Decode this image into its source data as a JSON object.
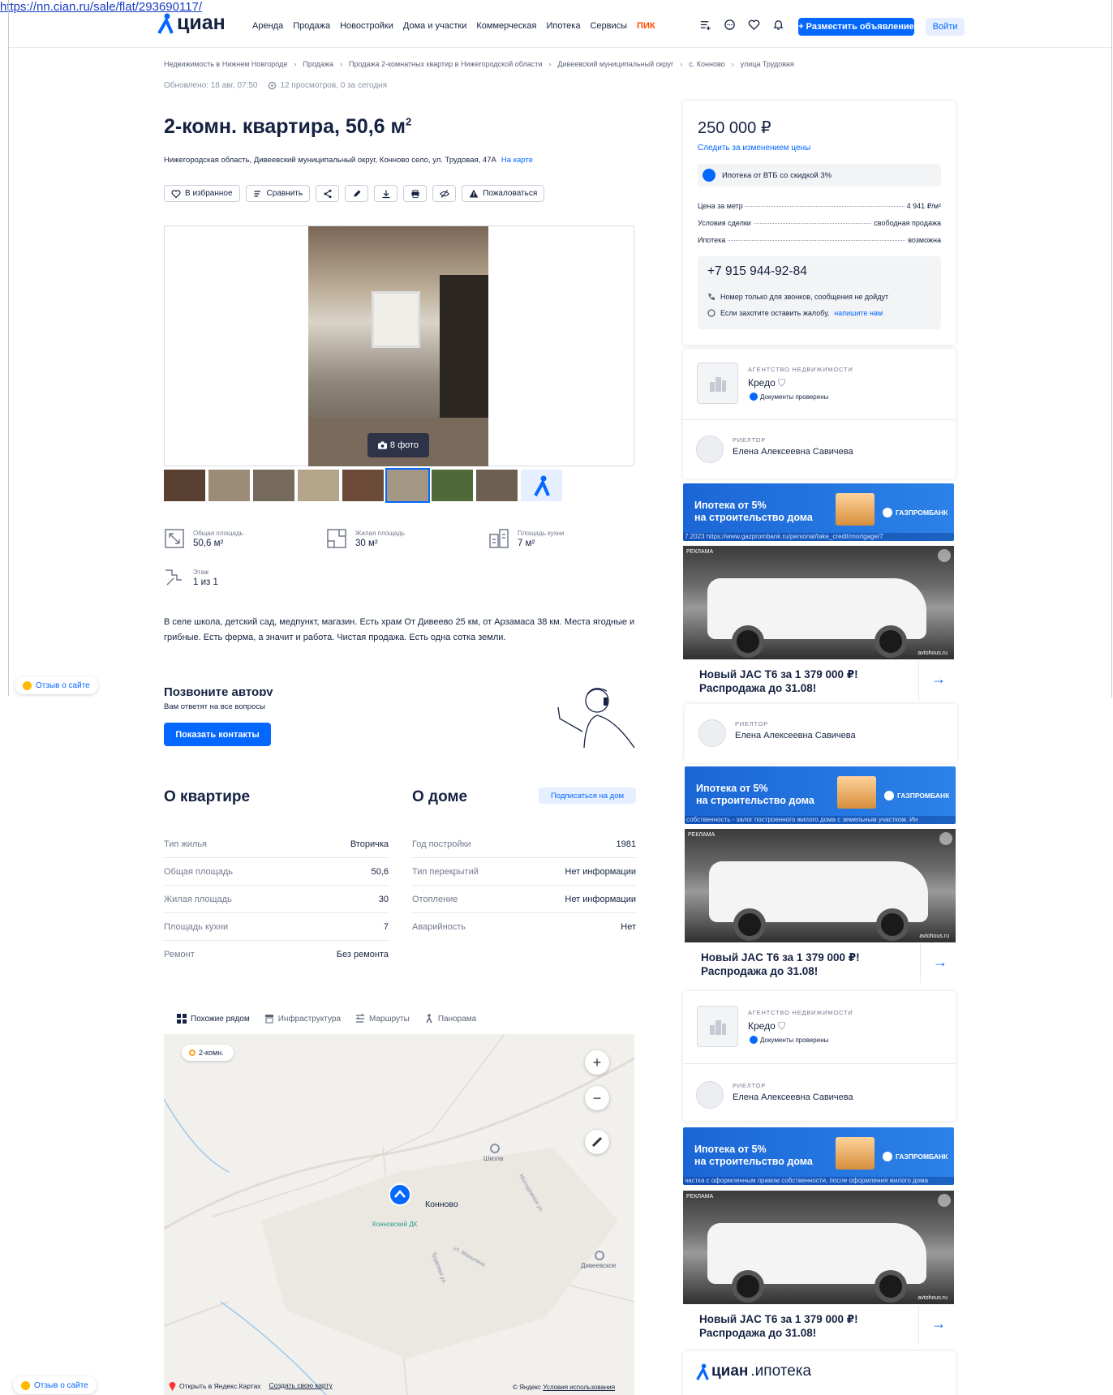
{
  "url": "https://nn.cian.ru/sale/flat/293690117/",
  "header": {
    "logo_text": "циан",
    "nav": [
      "Аренда",
      "Продажа",
      "Новостройки",
      "Дома и участки",
      "Коммерческая",
      "Ипотека",
      "Сервисы"
    ],
    "nav_pik": "ПИК",
    "post_button": "+ Разместить объявление",
    "login_button": "Войти"
  },
  "breadcrumbs": [
    "Недвижимость в Нижнем Новгороде",
    "Продажа",
    "Продажа 2-комнатных квартир в Нижегородской области",
    "Дивеевский муниципальный округ",
    "с. Конново",
    "улица Трудовая"
  ],
  "meta": {
    "updated": "Обновлено: 18 авг, 07:50",
    "views": "12 просмотров, 0 за сегодня"
  },
  "listing": {
    "title": "2-комн. квартира, 50,6 м",
    "title_sup": "2",
    "address": "Нижегородская область, Дивеевский муниципальный округ, Конново село, ул. Трудовая, 47А",
    "map_link": "На карте",
    "photo_count": "8 фото",
    "description": "В селе школа, детский сад, медпункт, магазин. Есть храм  От Дивеево 25 км, от Арзамаса 38 км. Места ягодные и грибные. Есть ферма, а значит и работа. Чистая продажа. Есть одна сотка земли."
  },
  "actions": {
    "favorite": "В избранное",
    "compare": "Сравнить",
    "report": "Пожаловаться"
  },
  "features": [
    {
      "label": "Общая площадь",
      "value": "50,6 м²"
    },
    {
      "label": "Жилая площадь",
      "value": "30 м²"
    },
    {
      "label": "Площадь кухни",
      "value": "7 м²"
    },
    {
      "label": "Этаж",
      "value": "1 из 1"
    }
  ],
  "feedback_label": "Отзыв о сайте",
  "call": {
    "title": "Позвоните автору",
    "subtitle": "Вам ответят на все вопросы",
    "button": "Показать контакты"
  },
  "about_flat": {
    "title": "О квартире",
    "rows": [
      {
        "k": "Тип жилья",
        "v": "Вторичка"
      },
      {
        "k": "Общая площадь",
        "v": "50,6"
      },
      {
        "k": "Жилая площадь",
        "v": "30"
      },
      {
        "k": "Площадь кухни",
        "v": "7"
      },
      {
        "k": "Ремонт",
        "v": "Без ремонта"
      }
    ]
  },
  "about_house": {
    "title": "О доме",
    "subscribe": "Подписаться на дом",
    "rows": [
      {
        "k": "Год постройки",
        "v": "1981"
      },
      {
        "k": "Тип перекрытий",
        "v": "Нет информации"
      },
      {
        "k": "Отопление",
        "v": "Нет информации"
      },
      {
        "k": "Аварийность",
        "v": "Нет"
      }
    ]
  },
  "map": {
    "tabs": [
      "Похожие рядом",
      "Инфраструктура",
      "Маршруты",
      "Панорама"
    ],
    "chip": "2-комн.",
    "labels": {
      "village": "Конново",
      "school": "Школа",
      "dk": "Конновский ДК",
      "diveevskoe": "Дивеевское",
      "street1": "Молодёжная ул.",
      "street2": "Трудовая ул.",
      "street3": "ул. Маныгина"
    },
    "open_yandex": "Открыть в Яндекс.Картах",
    "create_map": "Создать свою карту",
    "copyright": "© Яндекс",
    "terms": "Условия использования"
  },
  "sidebar": {
    "price": "250 000 ₽",
    "track": "Следить за изменением цены",
    "mortgage_offer": "Ипотека от ВТБ со скидкой 3%",
    "kv": [
      {
        "k": "Цена за метр",
        "v": "4 941 ₽/м²"
      },
      {
        "k": "Условия сделки",
        "v": "свободная продажа"
      },
      {
        "k": "Ипотека",
        "v": "возможна"
      }
    ],
    "phone": "+7 915 944-92-84",
    "note1": "Номер только для звонков, сообщения не дойдут",
    "note2": "Если захотите оставить жалобу,",
    "note2_link": "напишите нам",
    "agency_label": "АГЕНТСТВО НЕДВИЖИМОСТИ",
    "agency_name": "Кредо",
    "verified": "Документы проверены",
    "realtor_label": "РИЕЛТОР",
    "realtor_name": "Елена Алексеевна Савичева",
    "banner_text1": "Ипотека от 5%",
    "banner_text2": "на строительство дома",
    "banner_brand": "ГАЗПРОМБАНК",
    "banner_urls": [
      "7.2023 https://www.gazprombank.ru/personal/take_credit/mortgage/7",
      "собственность - залог построенного жилого дома с земельным участком. Ин",
      "частка с оформленным правом собственности, после оформления жилого дома"
    ],
    "ad_tag": "РЕКЛАМА",
    "ad_src": "avtohous.ru",
    "car_text": "Новый JAC T6 за 1 379 000 ₽! Распродажа до 31.08!",
    "cian_mortgage": "циан",
    "cian_mortgage_suffix": ".ипотека"
  }
}
